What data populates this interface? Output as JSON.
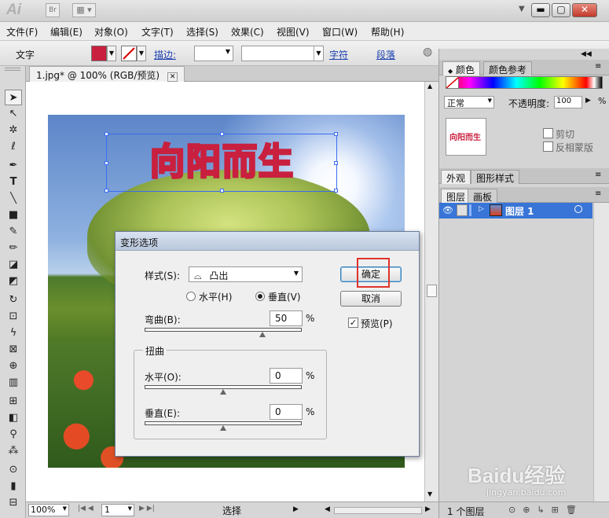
{
  "app": {
    "logo": "Ai",
    "bridge_label": "Br"
  },
  "menu": [
    "文件(F)",
    "编辑(E)",
    "对象(O)",
    "文字(T)",
    "选择(S)",
    "效果(C)",
    "视图(V)",
    "窗口(W)",
    "帮助(H)"
  ],
  "control": {
    "tool_label": "文字",
    "stroke_label": "描边:",
    "char_link": "字符",
    "para_link": "段落",
    "fill_color": "#c8203e"
  },
  "document": {
    "tab_title": "1.jpg* @ 100% (RGB/预览)",
    "art_text": "向阳而生"
  },
  "status": {
    "zoom": "100%",
    "page": "1",
    "mode": "选择"
  },
  "dialog": {
    "title": "变形选项",
    "style_label": "样式(S):",
    "style_value": "凸出",
    "horizontal_label": "水平(H)",
    "vertical_label": "垂直(V)",
    "bend_label": "弯曲(B):",
    "bend_value": "50",
    "bend_level": 0.75,
    "percent": "%",
    "distort_label": "扭曲",
    "dh_label": "水平(O):",
    "dh_value": "0",
    "dv_label": "垂直(E):",
    "dv_value": "0",
    "ok": "确定",
    "cancel": "取消",
    "preview": "预览(P)",
    "preview_checked": true,
    "vertical_selected": true
  },
  "panels": {
    "color_tab": "颜色",
    "color_ref_tab": "颜色参考",
    "blend_mode": "正常",
    "opacity_label": "不透明度:",
    "opacity_value": "100",
    "clip_label": "剪切",
    "invert_mask_label": "反相蒙版",
    "appearance_tab": "外观",
    "graphic_styles_tab": "图形样式",
    "layers_tab": "图层",
    "artboards_tab": "画板",
    "layer_name": "图层 1",
    "layer_count": "1 个图层"
  },
  "watermark": {
    "brand": "Baidu经验",
    "url": "jingyan.baidu.com"
  }
}
